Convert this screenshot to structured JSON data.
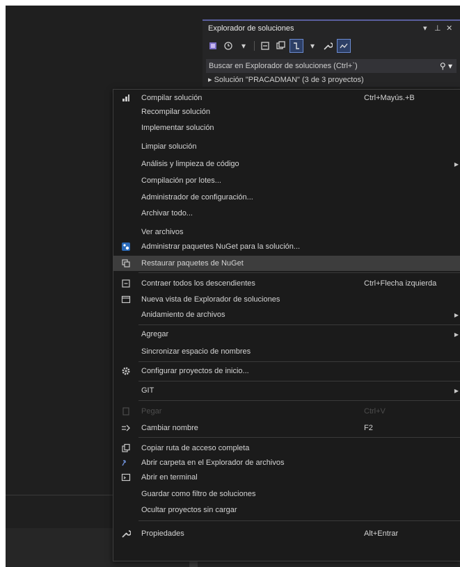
{
  "solution_explorer": {
    "title": "Explorador de soluciones",
    "controls": [
      "▾",
      "⊥",
      "✕"
    ],
    "toolbar_icons": [
      "vs-solution-icon",
      "history-icon",
      "dropdown-arrow-icon",
      "sync-icon",
      "collapse-icon",
      "show-all-icon",
      "switch-view-icon",
      "dropdown-arrow-icon",
      "properties-wrench-icon",
      "preview-icon"
    ],
    "search_placeholder": "Buscar en Explorador de soluciones (Ctrl+`)",
    "tree_partial": "▸ Solución \"PRACADMAN\" (3 de 3 proyectos)"
  },
  "context_menu": {
    "items": [
      {
        "label": "Compilar solución",
        "shortcut": "Ctrl+Mayús.+B",
        "icon": "build-icon"
      },
      {
        "label": "Recompilar solución"
      },
      {
        "label": "Implementar solución"
      },
      {
        "label": "Limpiar solución"
      },
      {
        "label": "Análisis y limpieza de código",
        "submenu": true
      },
      {
        "label": "Compilación por lotes..."
      },
      {
        "label": "Administrador de configuración..."
      },
      {
        "label": "Archivar todo..."
      },
      {
        "label": "Ver archivos"
      },
      {
        "label": "Administrar paquetes NuGet para la solución...",
        "icon": "nuget-icon"
      },
      {
        "label": "Restaurar paquetes de NuGet",
        "icon": "restore-packages-icon",
        "highlighted": true
      },
      {
        "label": "Contraer todos los descendientes",
        "shortcut": "Ctrl+Flecha izquierda",
        "icon": "collapse-all-icon"
      },
      {
        "label": "Nueva vista de Explorador de soluciones",
        "icon": "new-view-icon"
      },
      {
        "label": "Anidamiento de archivos",
        "submenu": true
      },
      {
        "label": "Agregar",
        "submenu": true
      },
      {
        "label": "Sincronizar espacio de nombres"
      },
      {
        "label": "Configurar proyectos de inicio...",
        "icon": "gear-icon"
      },
      {
        "label": "GIT",
        "submenu": true
      },
      {
        "label": "Pegar",
        "shortcut": "Ctrl+V",
        "icon": "paste-icon",
        "disabled": true
      },
      {
        "label": "Cambiar nombre",
        "shortcut": "F2",
        "icon": "rename-icon"
      },
      {
        "label": "Copiar ruta de acceso completa",
        "icon": "copy-path-icon"
      },
      {
        "label": "Abrir carpeta en el Explorador de archivos",
        "icon": "open-folder-icon"
      },
      {
        "label": "Abrir en terminal",
        "icon": "terminal-icon"
      },
      {
        "label": "Guardar como filtro de soluciones"
      },
      {
        "label": "Ocultar proyectos sin cargar"
      },
      {
        "label": "Propiedades",
        "shortcut": "Alt+Entrar",
        "icon": "wrench-icon"
      }
    ]
  },
  "colors": {
    "menu_background": "#1b1b1b",
    "highlight": "#3d3d3d",
    "panel_accent": "#5a5f9e"
  }
}
